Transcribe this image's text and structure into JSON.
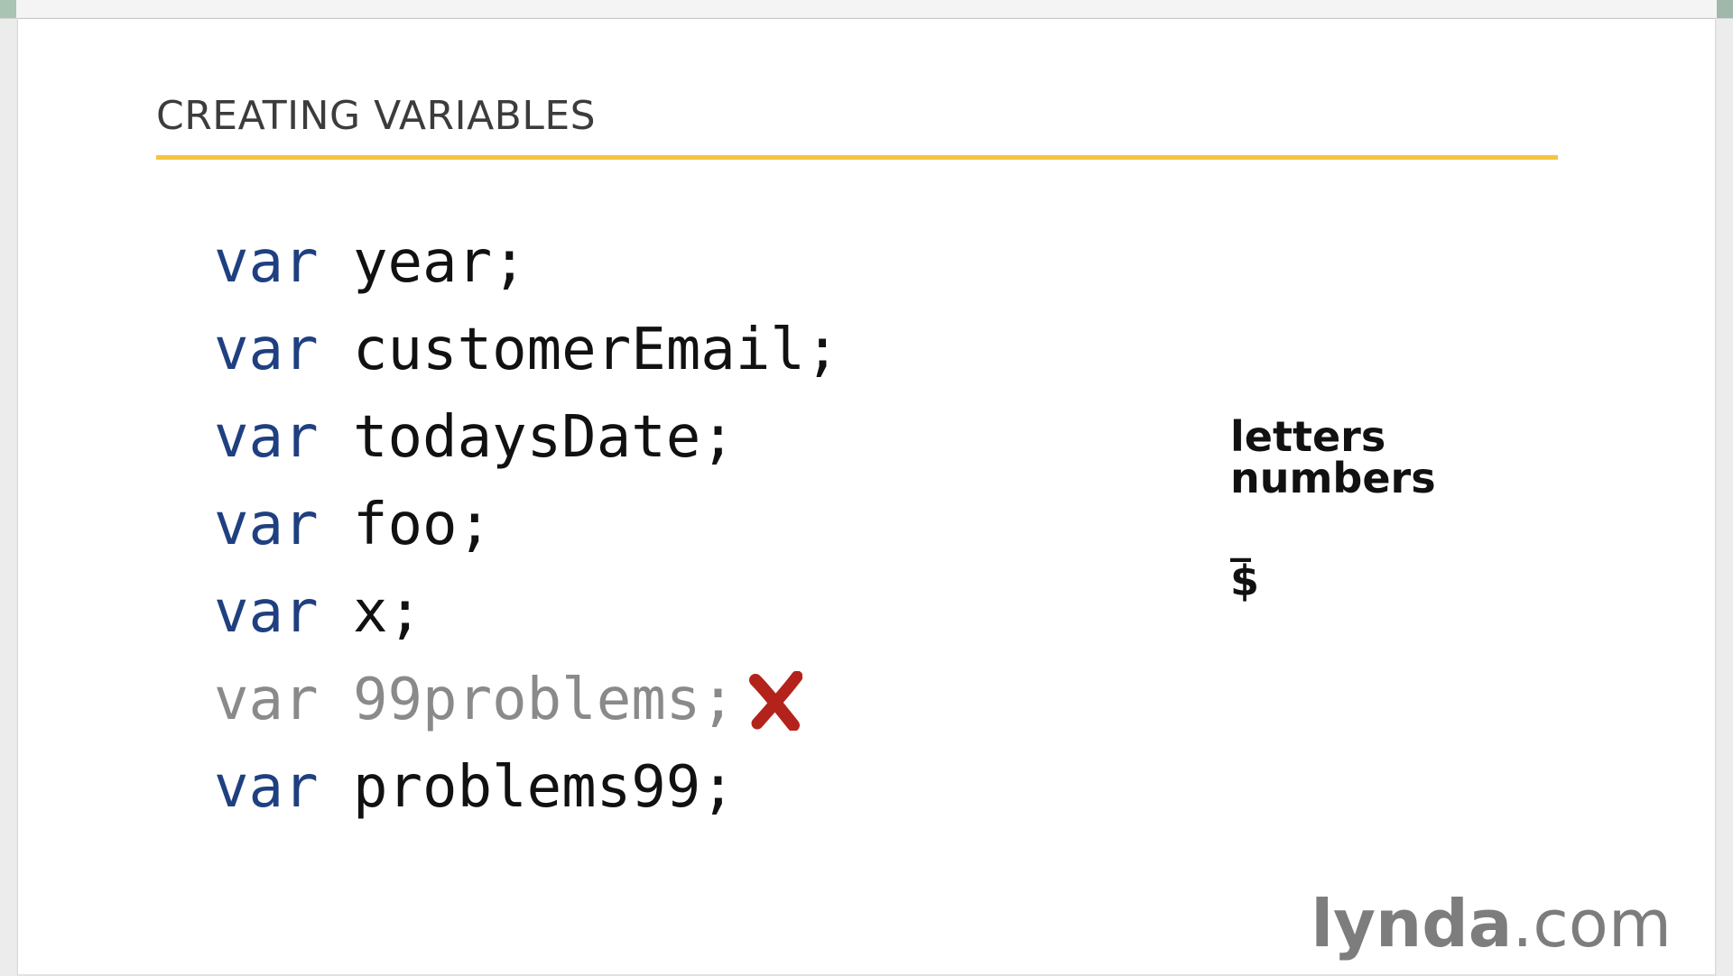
{
  "slide": {
    "title": "CREATING VARIABLES",
    "accent_color": "#f5c53f",
    "keyword_color": "#1f4080",
    "invalid_color": "#8a8a8a",
    "error_mark_color": "#b3231c",
    "code_lines": [
      {
        "keyword": "var",
        "identifier": "year;",
        "valid": true
      },
      {
        "keyword": "var",
        "identifier": "customerEmail;",
        "valid": true
      },
      {
        "keyword": "var",
        "identifier": "todaysDate;",
        "valid": true
      },
      {
        "keyword": "var",
        "identifier": "foo;",
        "valid": true
      },
      {
        "keyword": "var",
        "identifier": "x;",
        "valid": true
      },
      {
        "keyword": "var",
        "identifier": "99problems;",
        "valid": false,
        "mark_icon": "x-mark-icon"
      },
      {
        "keyword": "var",
        "identifier": "problems99;",
        "valid": true
      }
    ],
    "allowed_chars": {
      "letters": "letters",
      "numbers": "numbers",
      "underscore": "_",
      "dollar": "$"
    }
  },
  "brand": {
    "name_bold": "lynda",
    "name_light": ".com"
  }
}
